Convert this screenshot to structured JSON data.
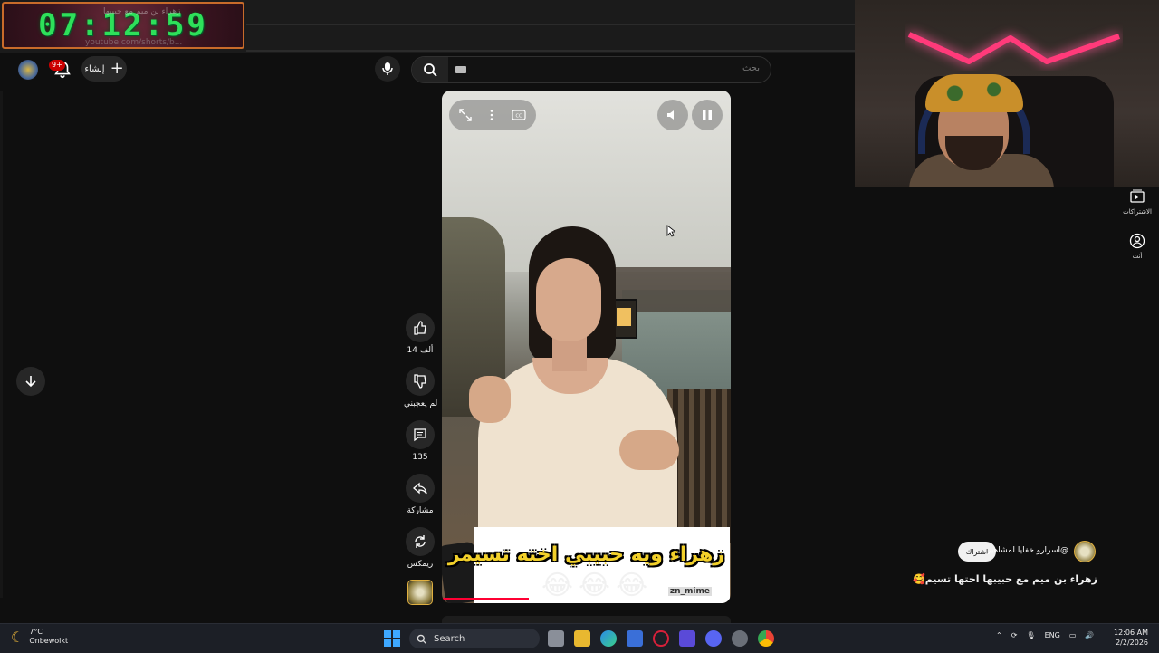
{
  "overlay_clock": {
    "time": "07:12:59",
    "top_text": "زهراء بن ميم مع حبيبها",
    "sub_text": "youtube.com/shorts/b..."
  },
  "header": {
    "notifications_badge": "9+",
    "create_label": "إنشاء",
    "search_placeholder": "بحث"
  },
  "short": {
    "caption_title": "زهراء ويه حبيبي اخته تسيمر",
    "caption_emoji": "😂😂😂",
    "caption_handle": "zn_mime",
    "progress_percent": 30,
    "like_count": "14 ألف",
    "dislike_label": "لم يعجبني",
    "comment_count": "135",
    "share_label": "مشاركة",
    "remix_label": "ريمكس",
    "channel_name": "@اسرارو خفايا لمشاهير",
    "subscribe_label": "اشتراك",
    "title": "زهراء بن ميم مع حبيبها اختها تسيم🥰"
  },
  "right_nav": {
    "subscriptions_label": "الاشتراكات",
    "you_label": "أنت"
  },
  "taskbar": {
    "weather_temp": "7°C",
    "weather_desc": "Onbewolkt",
    "search_label": "Search",
    "language": "ENG",
    "time": "12:06 AM",
    "date": "2/2/2026"
  },
  "colors": {
    "background": "#0f0f0f",
    "accent_red": "#ff0033",
    "clock_green": "#2ee05a",
    "neon_pink": "#ff3a7a"
  }
}
